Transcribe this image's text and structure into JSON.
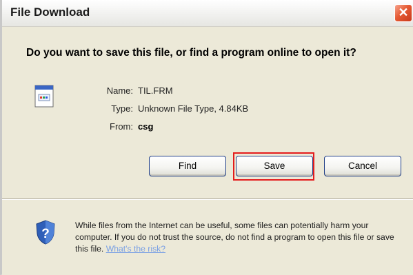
{
  "window": {
    "title": "File Download",
    "close_symbol": "✕"
  },
  "prompt": {
    "question": "Do you want to save this file, or find a program online to open it?"
  },
  "file": {
    "icon": "file-icon",
    "name_label": "Name:",
    "name_value": "TIL.FRM",
    "type_label": "Type:",
    "type_value": "Unknown File Type, 4.84KB",
    "from_label": "From:",
    "from_value": "csg"
  },
  "buttons": {
    "find": "Find",
    "save": "Save",
    "cancel": "Cancel",
    "highlight_color": "#e41b1b"
  },
  "warning": {
    "icon": "shield-question-icon",
    "text": "While files from the Internet can be useful, some files can potentially harm your computer. If you do not trust the source, do not find a program to open this file or save this file.",
    "link": "What's the risk?"
  }
}
